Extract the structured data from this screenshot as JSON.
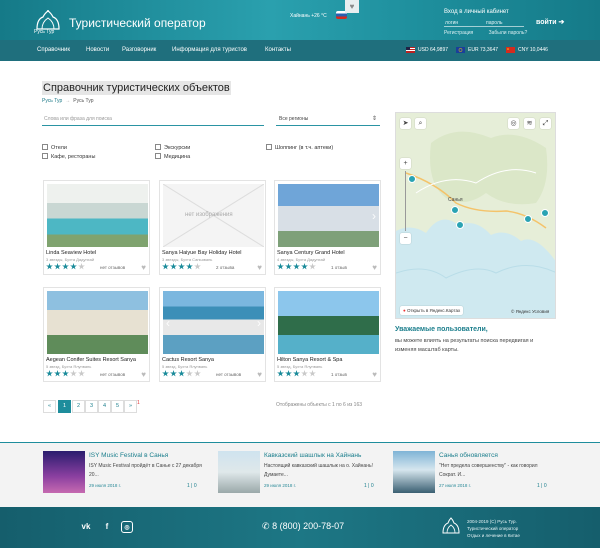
{
  "header": {
    "brand": "Туристический оператор",
    "logo_caption": "Русь Тур",
    "weather": "Хайнань +26 °C",
    "cabinet_title": "Вход в личный кабинет",
    "login_placeholder": "логин",
    "password_placeholder": "пароль",
    "register": "Регистрация",
    "forgot": "Забыли пароль?",
    "login_button": "войти"
  },
  "nav": {
    "items": [
      "Справочник",
      "Новости",
      "Разговорник",
      "Информация для туристов",
      "Контакты"
    ],
    "rates": [
      "USD 64,9897",
      "EUR 73,3647",
      "CNY 10,0446"
    ]
  },
  "page": {
    "title": "Справочник туристических объектов",
    "breadcrumb": [
      "Русь Тур",
      "Русь Тур"
    ],
    "search_placeholder": "Слова или фраза для поиска",
    "region_select": "Все регионы",
    "filters": [
      "Отели",
      "Кафе, рестораны",
      "Экскурсии",
      "Медицина",
      "Шоппинг (в т.ч. аптеки)"
    ]
  },
  "cards": [
    {
      "name": "Linda Seaview Hotel",
      "sub": "3 звезды, Бухта Дадунхай",
      "reviews": "нет отзывов",
      "rating": 4
    },
    {
      "name": "Sanya Haiyue Bay Holiday Hotel",
      "sub": "3 звезды, Бухта Саньявань",
      "reviews": "2 отзыва",
      "rating": 4,
      "no_image": "нет изображения"
    },
    {
      "name": "Sanya Century Grand Hotel",
      "sub": "4 звезды, Бухта Дадунхай",
      "reviews": "1 отзыв",
      "rating": 4
    },
    {
      "name": "Aegean Conifer Suites Resort Sanya",
      "sub": "5 звезд, Бухта Ялунвань",
      "reviews": "нет отзывов",
      "rating": 3
    },
    {
      "name": "Cactus Resort Sanya",
      "sub": "5 звезд, Бухта Ялунвань",
      "reviews": "нет отзывов",
      "rating": 3
    },
    {
      "name": "Hilton Sanya Resort & Spa",
      "sub": "5 звезд, Бухта Ялунвань",
      "reviews": "1 отзыв",
      "rating": 3
    }
  ],
  "pagination": {
    "pages": [
      "«",
      "1",
      "2",
      "3",
      "4",
      "5",
      "»"
    ],
    "active": "1",
    "extra": "1",
    "shown": "Отображены объекты с 1 по 6 из 163"
  },
  "map": {
    "open_link": "Открыть в Яндекс.Картах",
    "provider": "© Яндекс Условия",
    "city_label": "Санья",
    "notice_title": "Уважаемые пользователи,",
    "notice_text": "вы можете влиять на результаты поиска передвигая и изменяя масштаб карты."
  },
  "news": [
    {
      "title": "ISY Music Festival в Санья",
      "text": [
        "ISY Music Festival пройдёт в Санье с 27 декабря",
        "20..."
      ],
      "date": "29 июля 2018 г.",
      "likes": "1 | 0"
    },
    {
      "title": "Кавказский шашлык на Хайнань",
      "text": [
        "Настоящий кавказский шашлык на о. Хайнань!",
        "Думаете..."
      ],
      "date": "29 июля 2018 г.",
      "likes": "1 | 0"
    },
    {
      "title": "Санья обновляется",
      "text": [
        "\"Нет предела совершенству\" - как говорил",
        "Сократ. И..."
      ],
      "date": "27 июля 2018 г.",
      "likes": "1 | 0"
    }
  ],
  "footer": {
    "social": [
      "vk",
      "f",
      "ig"
    ],
    "phone": "8 (800) 200-78-07",
    "copyright": [
      "2004-2019 (С) Русь Тур.",
      "Туристический оператор",
      "Отдых и лечение в Китае"
    ]
  },
  "colors": {
    "accent": "#1e8d9c",
    "nav": "#1f6f7d",
    "star": "#1a8b9a"
  }
}
